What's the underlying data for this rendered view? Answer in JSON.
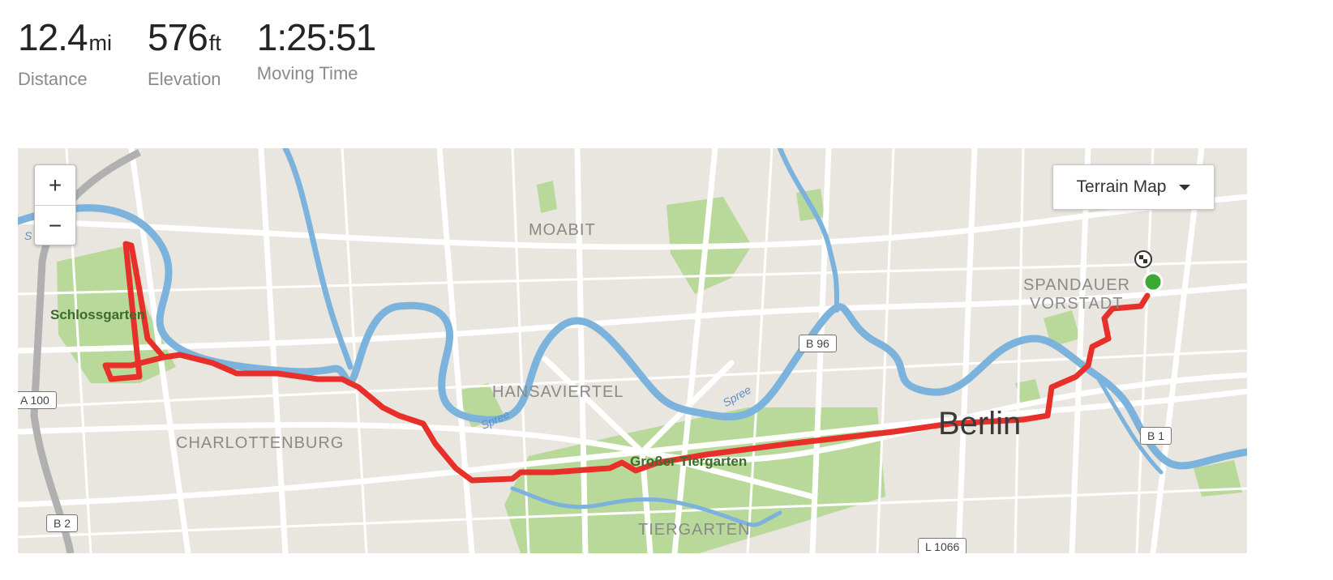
{
  "stats": {
    "distance": {
      "value": "12.4",
      "unit": "mi",
      "label": "Distance"
    },
    "elevation": {
      "value": "576",
      "unit": "ft",
      "label": "Elevation"
    },
    "moving_time": {
      "value": "1:25:51",
      "unit": "",
      "label": "Moving Time"
    }
  },
  "map": {
    "zoom_in": "+",
    "zoom_out": "−",
    "map_type": "Terrain Map",
    "labels": {
      "moabit": "MOABIT",
      "spandauer": "SPANDAUER",
      "vorstadt": "VORSTADT",
      "schlossgarten": "Schlossgarten",
      "hansaviertel": "HANSAVIERTEL",
      "charlottenburg": "CHARLOTTENBURG",
      "berlin": "Berlin",
      "grosser_tiergarten": "Großer Tiergarten",
      "tiergarten": "TIERGARTEN",
      "spree1": "Spree",
      "spree2": "Spree",
      "spree_edge": "S"
    },
    "road_signs": {
      "b96": "B 96",
      "a100": "A 100",
      "b1": "B 1",
      "b2": "B 2",
      "l1066": "L 1066"
    },
    "route_color": "#e8302a",
    "start_marker_color": "#3aaa35",
    "water_color": "#7cb3dd",
    "park_color": "#b9d99a"
  }
}
